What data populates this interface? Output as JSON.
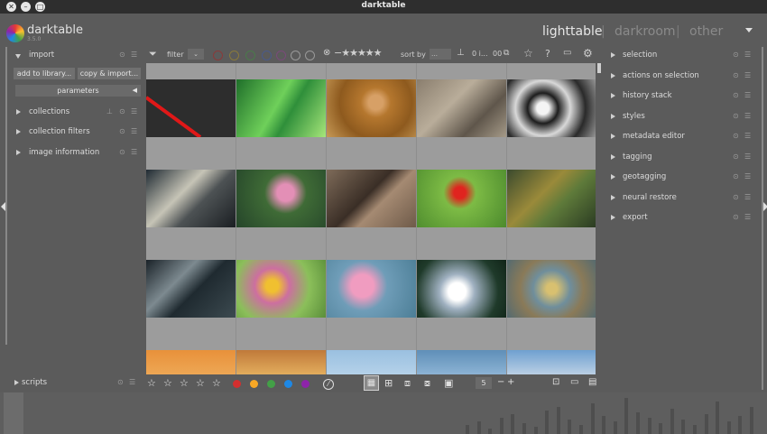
{
  "window": {
    "title": "darktable"
  },
  "app": {
    "name": "darktable",
    "version": "3.5.0"
  },
  "views": [
    {
      "label": "lighttable",
      "active": true
    },
    {
      "label": "darkroom",
      "active": false
    },
    {
      "label": "other",
      "active": false
    }
  ],
  "separators": [
    "|",
    "|"
  ],
  "left_panel": {
    "import": {
      "label": "import",
      "add_button": "add to library...",
      "copy_button": "copy & import...",
      "parameters": "parameters"
    },
    "modules": [
      {
        "label": "collections"
      },
      {
        "label": "collection filters"
      },
      {
        "label": "image information"
      }
    ],
    "scripts": {
      "label": "scripts"
    }
  },
  "filterbar": {
    "filter_label": "filter",
    "sort_label": "sort by",
    "sort_value": "…",
    "count_text": "0 i...",
    "grouping_text": "00"
  },
  "right_panel": {
    "modules": [
      {
        "label": "selection"
      },
      {
        "label": "actions on selection"
      },
      {
        "label": "history stack"
      },
      {
        "label": "styles"
      },
      {
        "label": "metadata editor"
      },
      {
        "label": "tagging"
      },
      {
        "label": "geotagging"
      },
      {
        "label": "neural restore"
      },
      {
        "label": "export"
      }
    ]
  },
  "bottombar": {
    "star_count": 5,
    "color_labels": [
      "#d32f2f",
      "#f9a825",
      "#43a047",
      "#1e88e5",
      "#8e24aa"
    ],
    "zoom_value": "5",
    "minus": "−",
    "plus": "+"
  },
  "icons": {
    "chevron_down": "chevron-down-icon",
    "filter": "funnel-icon",
    "star": "star-icon",
    "help": "question-icon",
    "settings": "gear-icon",
    "grid": "filemanager-icon"
  },
  "thumbnails": [
    {
      "bg": "linear-gradient(135deg,#2d2d2d 0%,#2d2d2d 100%)",
      "special": "red-line"
    },
    {
      "bg": "linear-gradient(120deg,#1f6f2a,#6fd05a 45%,#2f8f3a 60%,#a6e67a)"
    },
    {
      "bg": "radial-gradient(circle at 55% 40%,#d7a066 0 12%,#b5772e 25%,#8e5a1e 60%,#c79a57 100%)"
    },
    {
      "bg": "linear-gradient(135deg,#8a7e6e,#b9ad9a 40%,#5f564b 70%,#a59a88)"
    },
    {
      "bg": "radial-gradient(circle at 40% 50%,#f4f4f4 0 10%,#1d1d1d 25%,#d8d8d8 45%,#2a2a2a 70%,#9a9a9a)"
    },
    {
      "bg": "linear-gradient(135deg,#1f2a33,#c6c4b6 40%,#4d5254 60%,#1a1e22)"
    },
    {
      "bg": "radial-gradient(circle at 55% 40%,#e38fb6 0 14%,#3f6b36 35%,#25452a 100%)"
    },
    {
      "bg": "linear-gradient(135deg,#7e6b59,#3a2e26 45%,#a58a72 60%,#6e5a49)"
    },
    {
      "bg": "radial-gradient(circle at 48% 40%,#e0241f 0 10%,#7dbb45 28%,#4c8a2d 100%)"
    },
    {
      "bg": "linear-gradient(135deg,#3b4a2e,#9a8a3a 40%,#5e7a3a 60%,#2a3a22)"
    },
    {
      "bg": "linear-gradient(135deg,#1a2228,#7d8a90 35%,#1f2a30 55%,#3c4a50)"
    },
    {
      "bg": "radial-gradient(circle at 40% 45%,#f0c030 0 10%,#cc6fa0 28%,#8bbf5a 60%,#5a8e3a)"
    },
    {
      "bg": "radial-gradient(circle at 40% 45%,#f09cc0 0 18%,#6f9db8 40%,#4c7e96 100%)"
    },
    {
      "bg": "radial-gradient(circle at 45% 55%,#ffffff 0 15%,#9fb0c0 30%,#1f3a2a 70%,#102418)"
    },
    {
      "bg": "radial-gradient(circle at 50% 50%,#d8c070 0 10%,#6f8e9c 35%,#8a7a58 60%,#546a70)"
    },
    {
      "bg": "linear-gradient(180deg,#e8913a,#f0b060 60%,#c05a2a)"
    },
    {
      "bg": "linear-gradient(180deg,#c0793a,#f1c36b 60%,#8a4a22)"
    },
    {
      "bg": "linear-gradient(180deg,#9ac0e0,#c6dcef 70%,#dfe9f3)"
    },
    {
      "bg": "linear-gradient(180deg,#5f8fb8,#9fc2e0 60%,#dfe9f3)"
    },
    {
      "bg": "linear-gradient(180deg,#6fa0d0,#c8d8e8 50%,#a9a9a9)"
    }
  ]
}
